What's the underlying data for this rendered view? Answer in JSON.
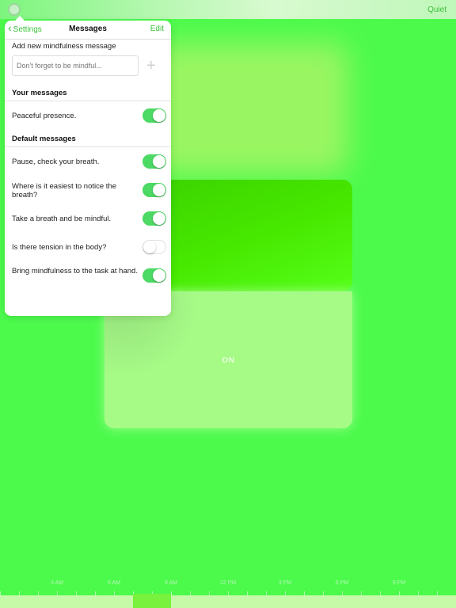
{
  "topbar": {
    "quiet_label": "Quiet"
  },
  "center": {
    "state_label": "ON"
  },
  "popover": {
    "back_label": "Settings",
    "title": "Messages",
    "edit_label": "Edit",
    "add_label": "Add new mindfulness message",
    "input_placeholder": "Don't forget to be mindful...",
    "your_messages_header": "Your messages",
    "your_messages": [
      {
        "label": "Peaceful presence.",
        "enabled": true
      }
    ],
    "default_messages_header": "Default messages",
    "default_messages": [
      {
        "label": "Pause, check your breath.",
        "enabled": true
      },
      {
        "label": "Where is it easiest to notice the breath?",
        "enabled": true
      },
      {
        "label": "Take a breath and be mindful.",
        "enabled": true
      },
      {
        "label": "Is there tension in the body?",
        "enabled": false
      },
      {
        "label": "Bring mindfulness to the task at hand.",
        "enabled": true
      }
    ]
  },
  "timeline": {
    "labels": [
      "3 AM",
      "6 AM",
      "9 AM",
      "12 PM",
      "3 PM",
      "6 PM",
      "9 PM"
    ]
  },
  "colors": {
    "background": "#4cfa4c",
    "accent": "#3cc43c",
    "toggle_on": "#4cd964"
  }
}
